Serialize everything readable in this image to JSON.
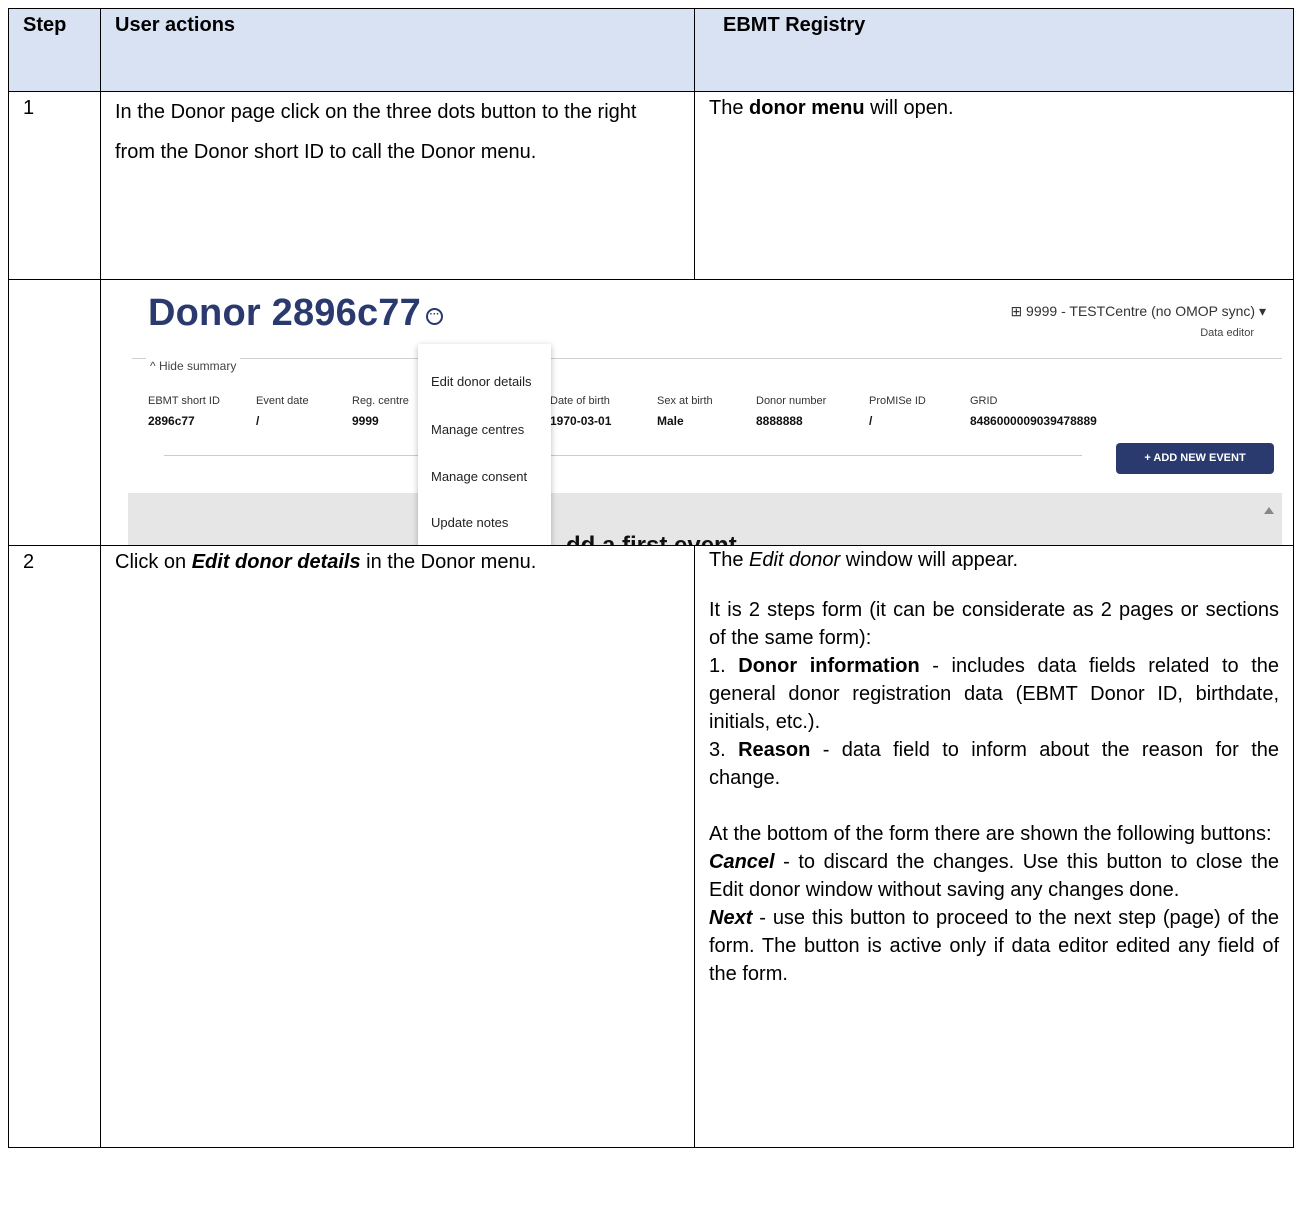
{
  "table": {
    "headers": {
      "step": "Step",
      "user_actions": "User actions",
      "registry": "EBMT Registry"
    },
    "row1": {
      "step": "1",
      "user_actions": "In the Donor page click on the three dots button to the right from the Donor short ID to call the Donor menu.",
      "registry_pre": "The ",
      "registry_bold": "donor menu",
      "registry_post": " will open."
    },
    "row2": {
      "step": "2",
      "ua_pre": "Click on ",
      "ua_bold": "Edit donor details",
      "ua_post": " in the Donor menu.",
      "p1_pre": "The ",
      "p1_em": "Edit donor",
      "p1_post": " window will appear.",
      "p2": "It is 2 steps  form (it can be considerate as 2 pages or sections of the same form):",
      "item1_num": "1. ",
      "item1_bold": "Donor information",
      "item1_text": " - includes data fields related to the general donor registration data (EBMT Donor ID, birthdate, initials, etc.).",
      "item2_num": "3. ",
      "item2_bold": "Reason",
      "item2_text": " - data field to inform about the reason for the change.",
      "p3": "At the bottom of the form there are shown the following buttons:",
      "cancel_label": "Cancel",
      "cancel_text": " - to discard the changes. Use this button to close the Edit donor window without saving any changes done.",
      "next_label": "Next",
      "next_text": " - use this button to proceed to the next step (page) of the form. The button is active only if data editor edited any field of the form."
    }
  },
  "screenshot": {
    "title": "Donor 2896c77",
    "centre": "⊞ 9999 - TESTCentre (no OMOP sync) ▾",
    "role": "Data editor",
    "hide_summary": "^  Hide summary",
    "fields": [
      {
        "label": "EBMT short ID",
        "value": "2896c77"
      },
      {
        "label": "Event date",
        "value": "/"
      },
      {
        "label": "Reg. centre",
        "value": "9999"
      },
      {
        "label": "Date of birth",
        "value": "1970-03-01"
      },
      {
        "label": "Sex at birth",
        "value": "Male"
      },
      {
        "label": "Donor number",
        "value": "8888888"
      },
      {
        "label": "ProMISe ID",
        "value": "/"
      },
      {
        "label": "GRID",
        "value": "8486000009039478889"
      }
    ],
    "add_button": "+  ADD NEW EVENT",
    "first_event": "dd a first event",
    "menu": [
      "Edit donor details",
      "Manage centres",
      "Manage consent",
      "Update notes"
    ]
  }
}
